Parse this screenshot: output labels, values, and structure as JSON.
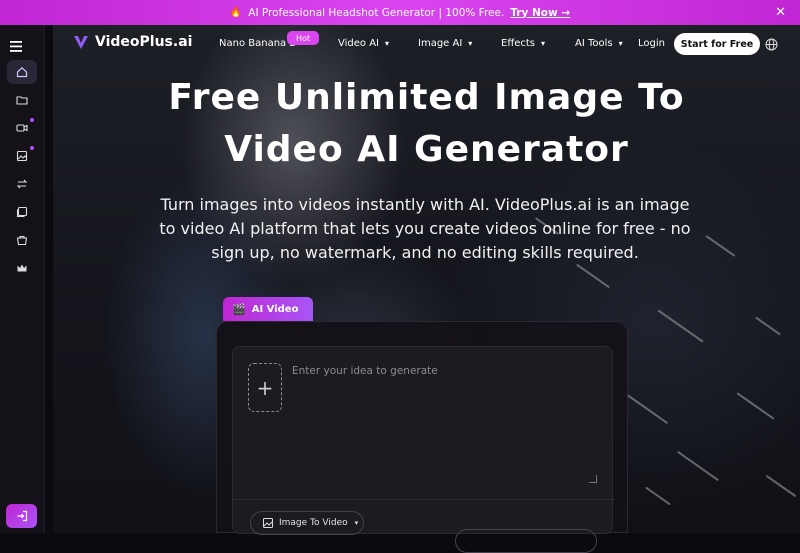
{
  "promo": {
    "text": "AI Professional Headshot Generator | 100% Free.",
    "link": "Try Now →",
    "close": "✕"
  },
  "nav": {
    "logo": "VideoPlus.ai",
    "items": [
      {
        "label": "Nano Banana 2"
      },
      {
        "label": "Video AI"
      },
      {
        "label": "Image AI"
      },
      {
        "label": "Effects"
      },
      {
        "label": "AI Tools"
      }
    ],
    "hot_badge": "Hot",
    "login": "Login",
    "start": "Start for Free"
  },
  "sidebar": {
    "icons": [
      "home-icon",
      "folder-icon",
      "video-icon",
      "image-icon",
      "swap-icon",
      "gallery-icon",
      "shop-icon",
      "crown-icon"
    ],
    "login_icon": "login-icon"
  },
  "hero": {
    "title_line1": "Free Unlimited Image To",
    "title_line2": "Video AI Generator",
    "subtitle": "Turn images into videos instantly with AI. VideoPlus.ai is an image to video AI platform that lets you create videos online for free - no sign up, no watermark, and no editing skills required."
  },
  "generator": {
    "tab": "AI Video",
    "placeholder": "Enter your idea to generate",
    "mode": "Image To Video"
  },
  "colors": {
    "accent": "#d946ef",
    "accent2": "#a855f7"
  }
}
